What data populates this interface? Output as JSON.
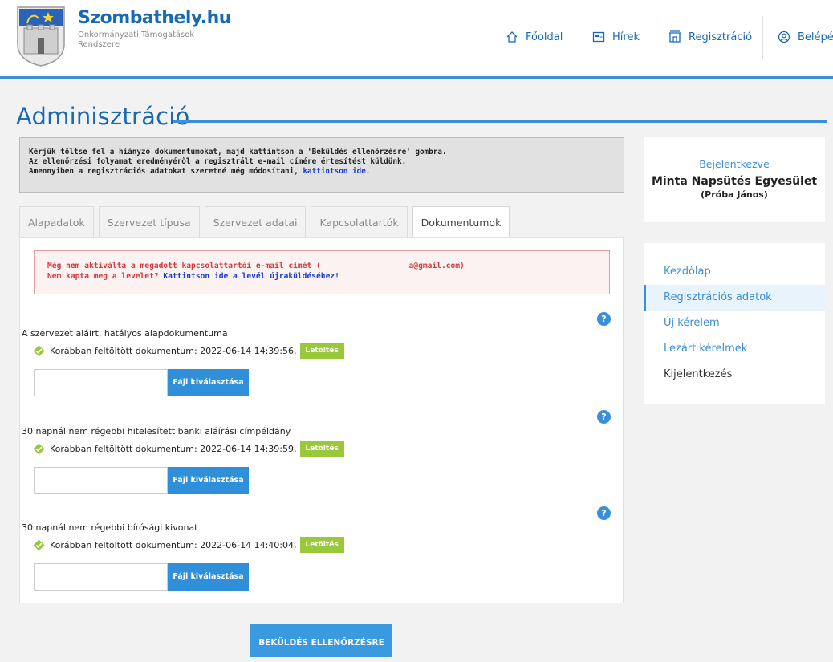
{
  "header": {
    "brand_title": "Szombathely.hu",
    "brand_sub": "Önkormányzati Támogatások Rendszere",
    "nav": [
      {
        "label": "Főoldal",
        "icon": "home-icon"
      },
      {
        "label": "Hírek",
        "icon": "news-icon"
      },
      {
        "label": "Regisztráció",
        "icon": "building-icon"
      },
      {
        "label": "Belépé",
        "icon": "user-circle-icon"
      }
    ]
  },
  "page_title": "Adminisztráció",
  "info": {
    "line1": "Kérjük töltse fel a hiányzó dokumentumokat, majd kattintson a 'Beküldés ellenőrzésre' gombra.",
    "line2": "Az ellenőrzési folyamat eredményéről a regisztrált e-mail címére értesítést küldünk.",
    "line3_prefix": "Amennyiben a regisztrációs adatokat szeretné még módosítani, ",
    "line3_link": "kattintson ide."
  },
  "tabs": [
    "Alapadatok",
    "Szervezet típusa",
    "Szervezet adatai",
    "Kapcsolattartók",
    "Dokumentumok"
  ],
  "alert": {
    "line1": "Még nem aktiválta a megadott kapcsolattartói e-mail címét (                   a@gmail.com)",
    "line2_prefix": "Nem kapta meg a levelet? ",
    "line2_link": "Kattintson ide a levél újraküldéséhez!"
  },
  "documents": [
    {
      "title": "A szervezet aláírt, hatályos alapdokumentuma",
      "status": "Korábban feltöltött dokumentum: 2022-06-14 14:39:56,"
    },
    {
      "title": "30 napnál nem régebbi hitelesített banki aláírási címpéldány",
      "status": "Korábban feltöltött dokumentum: 2022-06-14 14:39:59,"
    },
    {
      "title": "30 napnál nem régebbi bírósági kivonat",
      "status": "Korábban feltöltött dokumentum: 2022-06-14 14:40:04,"
    }
  ],
  "download_label": "Letöltés",
  "file_button_label": "Fájl kiválasztása",
  "help_label": "?",
  "submit_label": "BEKÜLDÉS ELLENŐRZÉSRE",
  "login": {
    "label": "Bejelentkezve",
    "org": "Minta Napsütés Egyesület",
    "person": "(Próba János)"
  },
  "sidebar": [
    "Kezdőlap",
    "Regisztrációs adatok",
    "Új kérelem",
    "Lezárt kérelmek",
    "Kijelentkezés"
  ],
  "colors": {
    "accent": "#3a8fd6",
    "brand": "#1769b6",
    "success": "#99c93a",
    "error": "#d23b3b"
  }
}
